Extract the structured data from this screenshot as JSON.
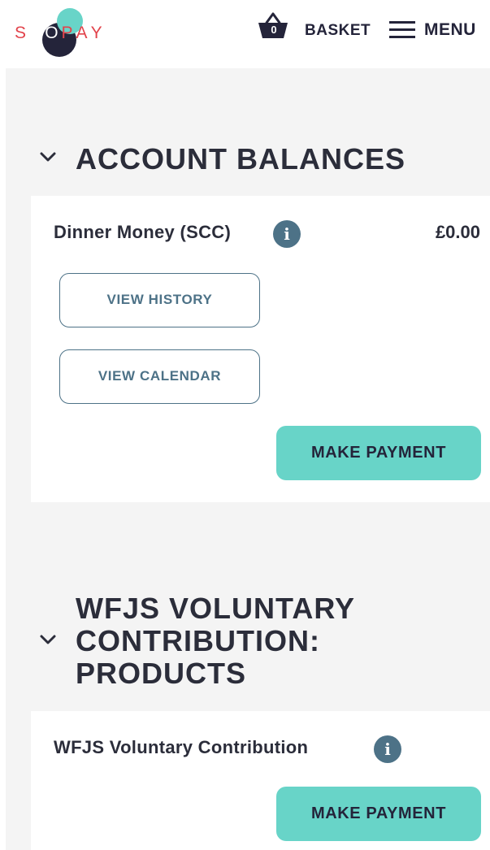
{
  "header": {
    "logo_letters": [
      "S",
      "C",
      "O",
      "P",
      "A",
      "Y"
    ],
    "basket_count": "0",
    "basket_label": "BASKET",
    "menu_label": "MENU"
  },
  "sections": [
    {
      "title": "ACCOUNT BALANCES",
      "items": [
        {
          "name": "Dinner Money (SCC)",
          "amount": "£0.00",
          "view_history_label": "VIEW HISTORY",
          "view_calendar_label": "VIEW CALENDAR",
          "pay_label": "MAKE PAYMENT"
        }
      ]
    },
    {
      "title_lines": [
        "WFJS VOLUNTARY",
        "CONTRIBUTION:",
        "PRODUCTS"
      ],
      "items": [
        {
          "name": "WFJS Voluntary Contribution",
          "pay_label": "MAKE PAYMENT"
        }
      ]
    }
  ],
  "colors": {
    "accent_teal": "#68d4c8",
    "brand_red": "#e2434b",
    "info_blue": "#4d7287",
    "navy": "#24243a",
    "page_background": "#f4f4f4"
  },
  "icons": [
    "basket-icon",
    "menu-icon",
    "chevron-down-icon",
    "info-icon"
  ]
}
